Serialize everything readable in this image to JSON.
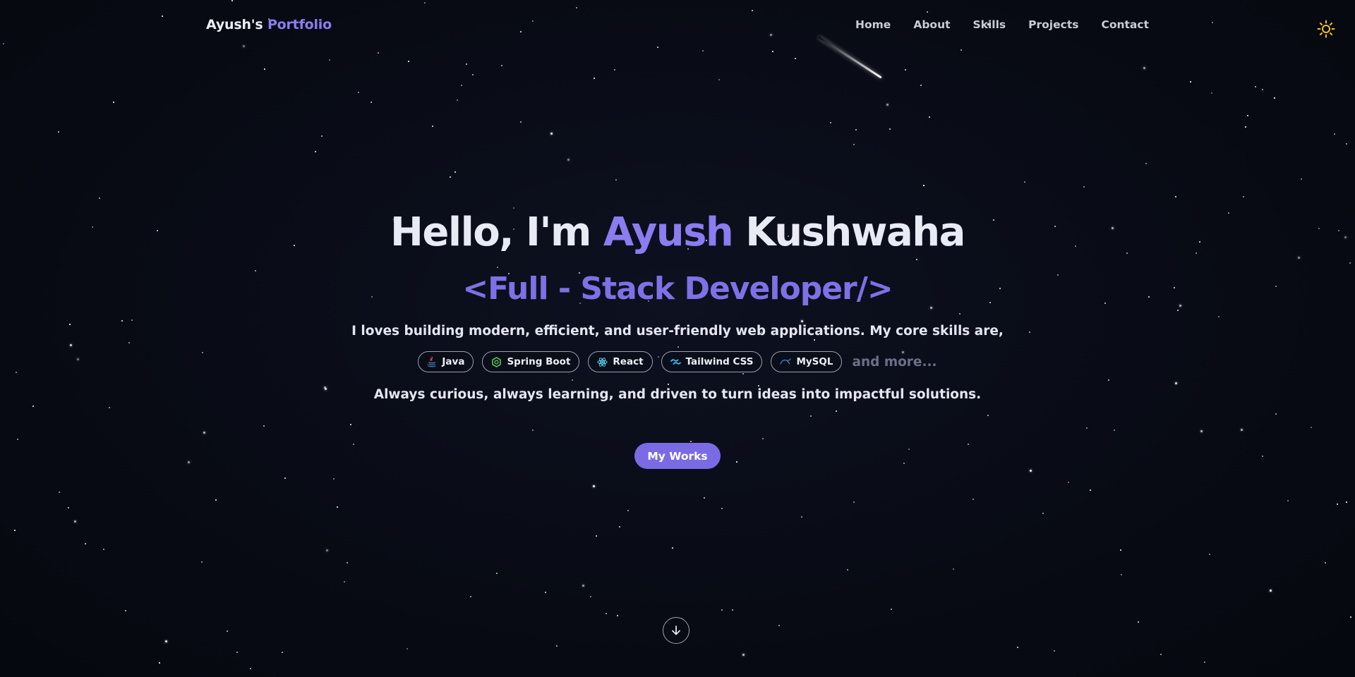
{
  "brand": {
    "first": "Ayush's",
    "second": "Portfolio"
  },
  "nav": [
    "Home",
    "About",
    "Skills",
    "Projects",
    "Contact"
  ],
  "theme_toggle": {
    "icon": "sun-icon"
  },
  "hero": {
    "greeting": "Hello, I'm",
    "first_name": "Ayush",
    "last_name": "Kushwaha",
    "role": "<Full - Stack Developer/>",
    "description": "I loves building modern, efficient, and user-friendly web applications. My core skills are,",
    "skills": [
      {
        "label": "Java",
        "icon": "java-icon",
        "color": "#e2463d"
      },
      {
        "label": "Spring Boot",
        "icon": "spring-boot-icon",
        "color": "#5fd15a"
      },
      {
        "label": "React",
        "icon": "react-icon",
        "color": "#61dafb"
      },
      {
        "label": "Tailwind CSS",
        "icon": "tailwind-icon",
        "color": "#38bdf8"
      },
      {
        "label": "MySQL",
        "icon": "mysql-icon",
        "color": "#3d7fc4"
      }
    ],
    "more": "and more...",
    "tagline": "Always curious, always learning, and driven to turn ideas into impactful solutions.",
    "cta": "My Works"
  },
  "scroll_icon": "arrow-down-icon",
  "colors": {
    "background": "#080b14",
    "accent": "#8b7cf0",
    "button": "#7a6ae4",
    "sun": "#f5c518"
  }
}
